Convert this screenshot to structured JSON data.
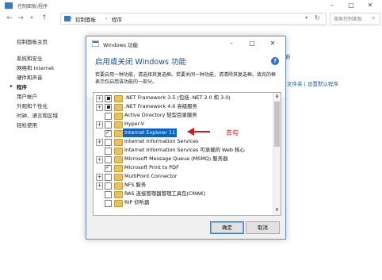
{
  "control_panel": {
    "title": "控制面板\\程序",
    "breadcrumb": [
      "控制面板",
      "程序"
    ],
    "search_placeholder": "搜索控制面板",
    "sidebar": [
      {
        "label": "控制面板主页",
        "link": false
      },
      {
        "label": "系统和安全",
        "link": false
      },
      {
        "label": "网络和 Internet",
        "link": false
      },
      {
        "label": "硬件和声音",
        "link": false
      },
      {
        "label": "程序",
        "link": false,
        "current": true
      },
      {
        "label": "用户帐户",
        "link": false
      },
      {
        "label": "外观和个性化",
        "link": false
      },
      {
        "label": "时钟、语言和区域",
        "link": false
      },
      {
        "label": "轻松使用",
        "link": false
      }
    ],
    "right_link_fragment_1": "新",
    "right_link_fragment_2": "文件夹  |  设置默认程序"
  },
  "dialog": {
    "title": "Windows 功能",
    "heading": "启用或关闭 Windows 功能",
    "description": "若要启用一种功能，请选择其复选框。若要关闭一种功能，请清除其复选框。填充的框表示仅启用该功能的一部分。",
    "features": [
      {
        "label": ".NET Framework 3.5 (包括 .NET 2.0 和 3.0)",
        "expander": "+",
        "state": "partial"
      },
      {
        "label": ".NET Framework 4.6 高级服务",
        "expander": "+",
        "state": "partial"
      },
      {
        "label": "Active Directory 轻型目录服务",
        "expander": "",
        "state": "unchecked"
      },
      {
        "label": "Hyper-V",
        "expander": "+",
        "state": "unchecked"
      },
      {
        "label": "Internet Explorer 11",
        "expander": "",
        "state": "checked",
        "selected": true
      },
      {
        "label": "Internet Information Services",
        "expander": "+",
        "state": "unchecked"
      },
      {
        "label": "Internet Information Services 可承载的 Web 核心",
        "expander": "",
        "state": "unchecked"
      },
      {
        "label": "Microsoft Message Queue (MSMQ) 服务器",
        "expander": "+",
        "state": "unchecked"
      },
      {
        "label": "Microsoft Print to PDF",
        "expander": "",
        "state": "checked"
      },
      {
        "label": "MultiPoint Connector",
        "expander": "+",
        "state": "unchecked"
      },
      {
        "label": "NFS 服务",
        "expander": "+",
        "state": "unchecked"
      },
      {
        "label": "RAS 连接管理器管理工具包(CMAK)",
        "expander": "",
        "state": "unchecked"
      },
      {
        "label": "RIP 侦听器",
        "expander": "",
        "state": "unchecked"
      }
    ],
    "ok_label": "确定",
    "cancel_label": "取消"
  },
  "annotation": {
    "text": "去勾",
    "color": "#d11a1a"
  },
  "colors": {
    "accent": "#0a64c8",
    "heading": "#1a4e8a",
    "link": "#1a56a8"
  }
}
